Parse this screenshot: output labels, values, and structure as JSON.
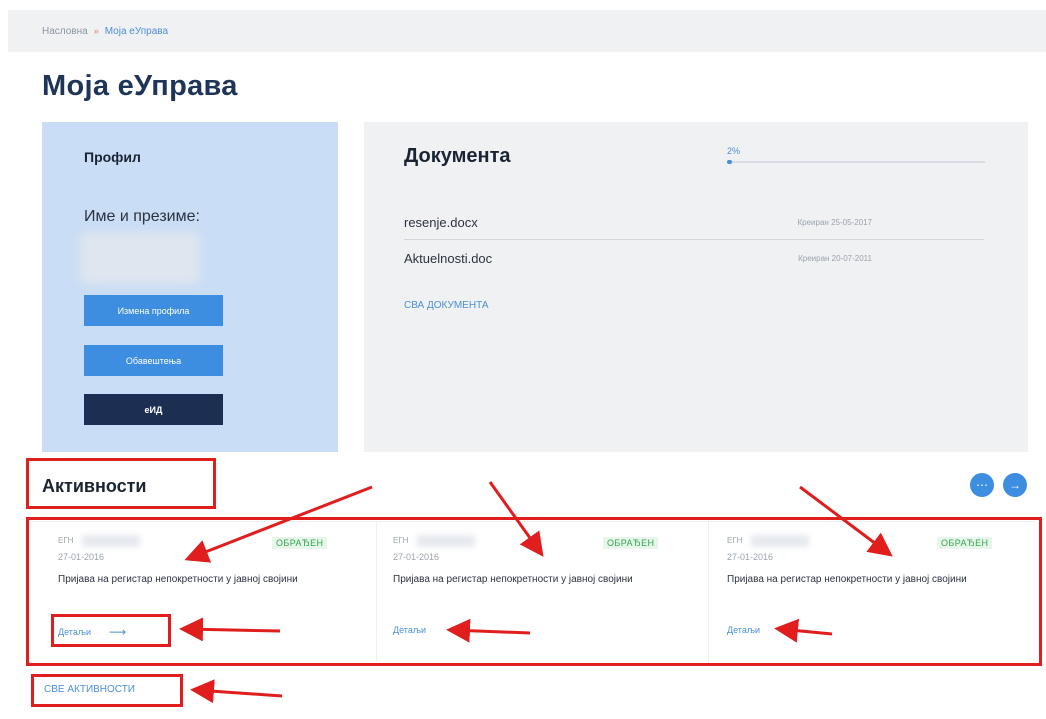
{
  "breadcrumb": {
    "home": "Насловна",
    "separator": "»",
    "current": "Моја еУправа"
  },
  "page_title": "Моја еУправа",
  "profile": {
    "heading": "Профил",
    "name_label": "Име и презиме:",
    "buttons": {
      "edit": "Измена профила",
      "notifications": "Обавештења",
      "eid": "еИД"
    }
  },
  "documents": {
    "heading": "Документа",
    "progress_label": "2%",
    "progress_fraction": 0.02,
    "items": [
      {
        "name": "resenje.docx",
        "date": "Креиран 25-05-2017"
      },
      {
        "name": "Aktuelnosti.doc",
        "date": "Креиран 20-07-2011"
      }
    ],
    "all_link": "СВА ДОКУМЕНТА"
  },
  "activities": {
    "heading": "Активности",
    "prev_icon": "ellipsis-icon",
    "next_icon": "arrow-right-icon",
    "items": [
      {
        "egn": "ЕГН",
        "status": "ОБРАЂЕН",
        "date": "27-01-2016",
        "description": "Пријава на регистар непокретности у јавној својини",
        "details": "Детаљи"
      },
      {
        "egn": "ЕГН",
        "status": "ОБРАЂЕН",
        "date": "27-01-2016",
        "description": "Пријава на регистар непокретности у јавној својини",
        "details": "Детаљи"
      },
      {
        "egn": "ЕГН",
        "status": "ОБРАЂЕН",
        "date": "27-01-2016",
        "description": "Пријава на регистар непокретности у јавној својини",
        "details": "Детаљи"
      }
    ],
    "all_link": "СВЕ АКТИВНОСТИ"
  },
  "colors": {
    "accent": "#3d8de0",
    "navy": "#1c2f52",
    "profile_bg": "#c9ddf6",
    "status_green": "#2fa84f",
    "annotation_red": "#e01e1e"
  }
}
